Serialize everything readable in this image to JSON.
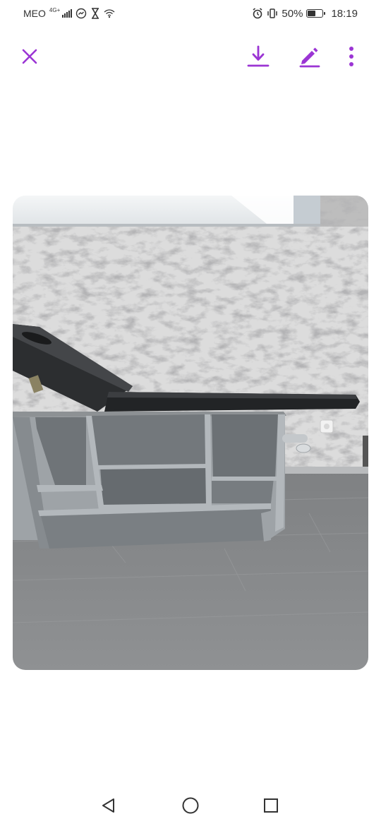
{
  "status_bar": {
    "carrier": "MEO",
    "network": "4G+",
    "battery_percent": "50%",
    "battery_level": 0.5,
    "time": "18:19"
  },
  "app_bar": {
    "accent_color": "#9b35d4",
    "actions": [
      "close-icon",
      "download-icon",
      "edit-icon",
      "more-vert-icon"
    ]
  },
  "photo": {
    "subject": "grey treatment table with open shelves and black padded top"
  },
  "nav_bar": {
    "buttons": [
      "back-triangle-icon",
      "home-circle-icon",
      "recents-square-icon"
    ]
  }
}
